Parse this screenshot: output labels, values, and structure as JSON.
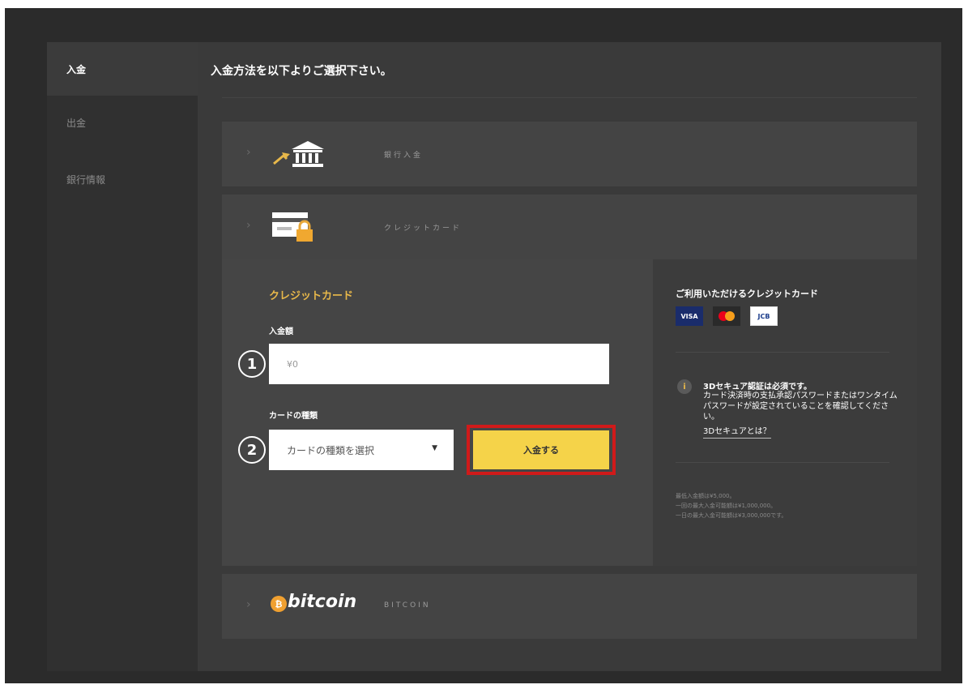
{
  "sidebar": {
    "items": [
      {
        "label": "入金",
        "active": true
      },
      {
        "label": "出金",
        "active": false
      },
      {
        "label": "銀行情報",
        "active": false
      }
    ]
  },
  "main": {
    "heading": "入金方法を以下よりご選択下さい。",
    "methods": {
      "bank": {
        "label": "銀行入金",
        "icon": "bank-icon"
      },
      "credit": {
        "label": "クレジットカード",
        "icon": "credit-card-lock-icon"
      },
      "bitcoin": {
        "logo_text": "bitcoin",
        "label": "BITCOIN",
        "icon": "bitcoin-icon"
      }
    }
  },
  "credit_form": {
    "title": "クレジットカード",
    "amount_label": "入金額",
    "amount_placeholder": "¥0",
    "card_type_label": "カードの種類",
    "card_type_select": "カードの種類を選択",
    "submit_label": "入金する",
    "step1": "1",
    "step2": "2"
  },
  "credit_info": {
    "title": "ご利用いただけるクレジットカード",
    "cards": [
      "VISA",
      "Mastercard",
      "JCB"
    ],
    "visa_label": "VISA",
    "jcb_label": "JCB",
    "secure_title": "3Dセキュア認証は必須です。",
    "secure_text": "カード決済時の支払承認パスワードまたはワンタイムパスワードが設定されていることを確認してください。",
    "secure_link": "3Dセキュアとは？",
    "limits": [
      "最低入金額は¥5,000。",
      "一回の最大入金可能額は¥1,000,000。",
      "一日の最大入金可能額は¥3,000,000です。"
    ]
  },
  "colors": {
    "accent_gold": "#e8b84a",
    "submit_yellow": "#f5d349",
    "highlight_red": "#d01a1a"
  }
}
